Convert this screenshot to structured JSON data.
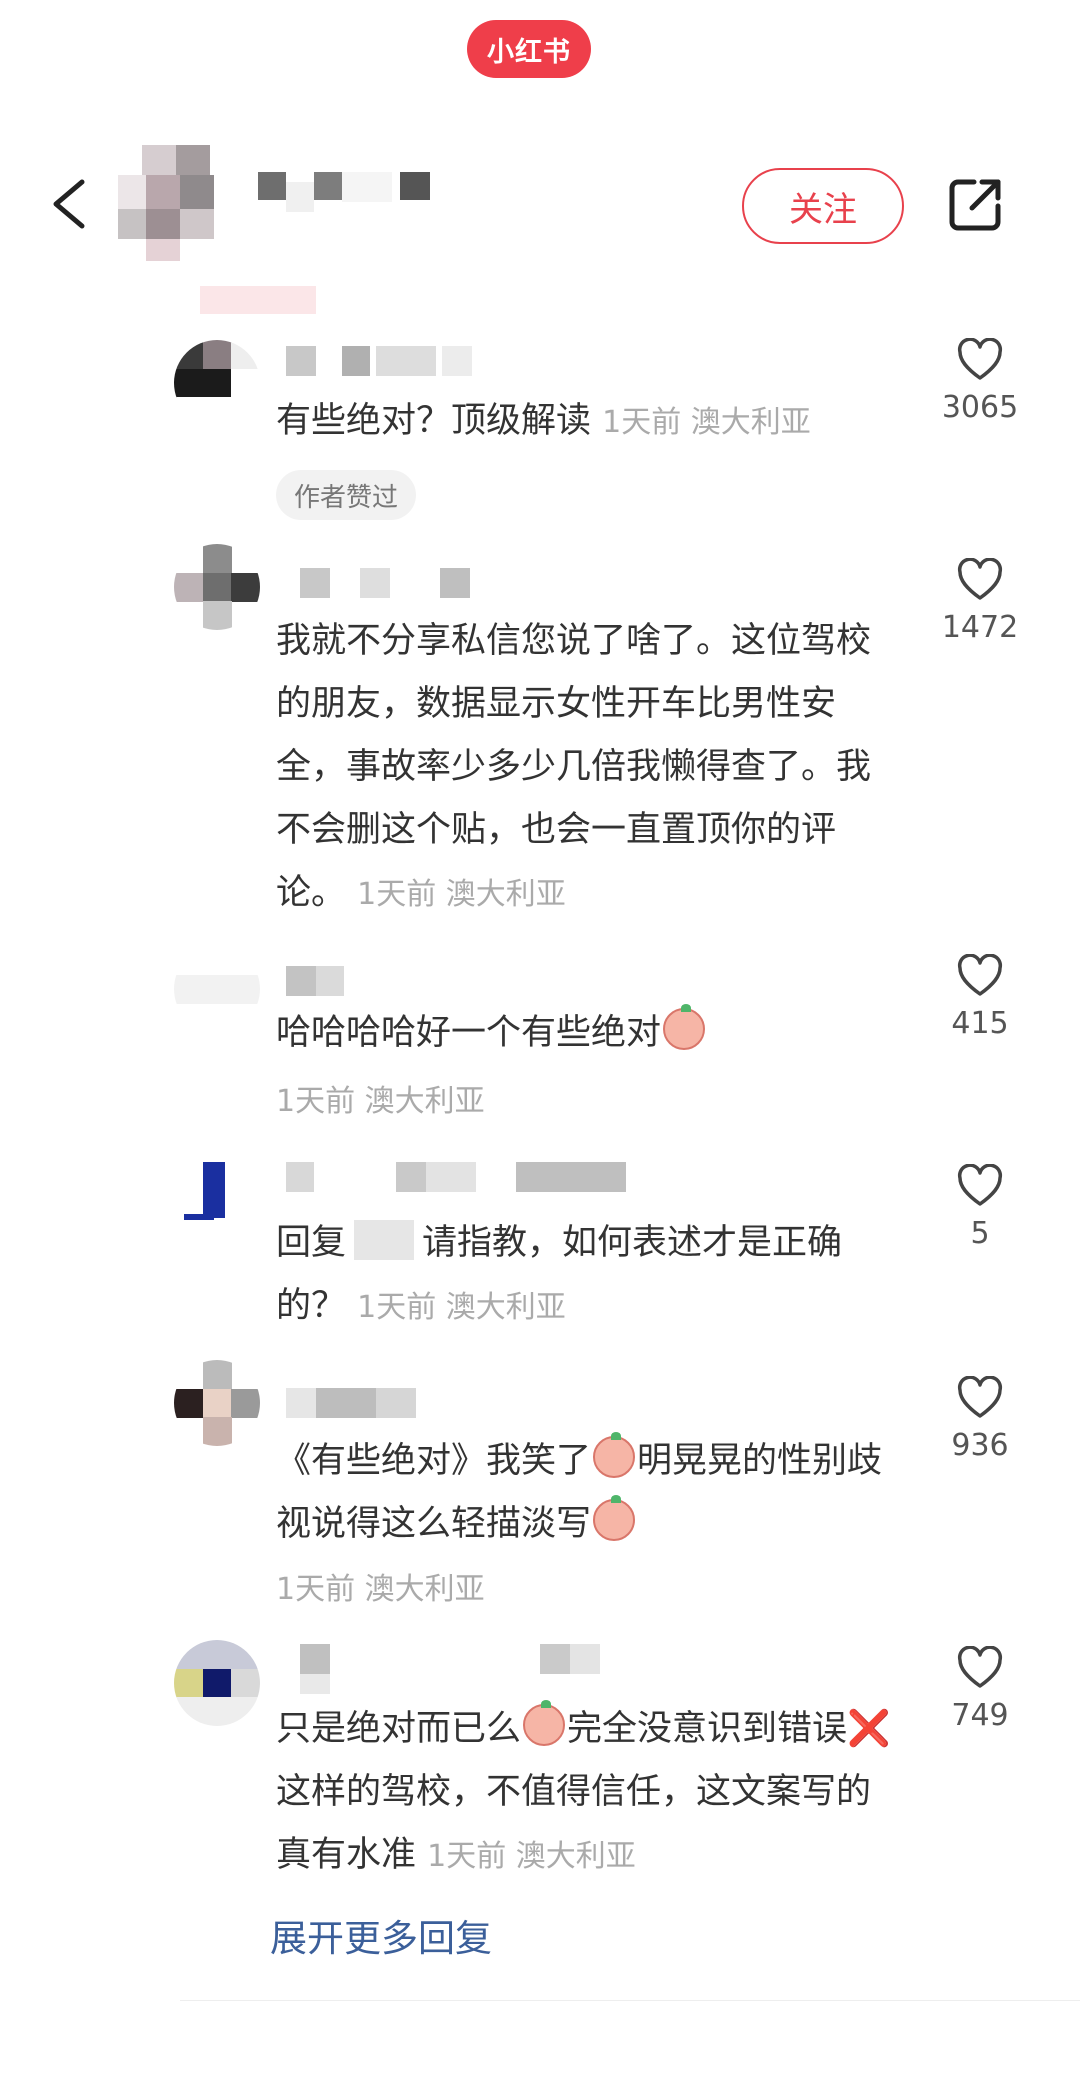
{
  "app": {
    "watermark": "小红书"
  },
  "header": {
    "follow_label": "关注"
  },
  "comments": [
    {
      "text": "有些绝对？顶级解读",
      "time": "1天前",
      "location": "澳大利亚",
      "likes": "3065",
      "badge": "作者赞过"
    },
    {
      "text": "我就不分享私信您说了啥了。这位驾校的朋友，数据显示女性开车比男性安全，事故率少多少几倍我懒得查了。我不会删这个贴，也会一直置顶你的评论。",
      "time": "1天前",
      "location": "澳大利亚",
      "likes": "1472"
    },
    {
      "text": "哈哈哈哈好一个有些绝对",
      "time": "1天前",
      "location": "澳大利亚",
      "likes": "415"
    },
    {
      "text_prefix": "回复",
      "text": "请指教，如何表述才是正确的？",
      "time": "1天前",
      "location": "澳大利亚",
      "likes": "5"
    },
    {
      "text_a": "《有些绝对》我笑了",
      "text_b": "明晃晃的性别歧视说得这么轻描淡写",
      "time": "1天前",
      "location": "澳大利亚",
      "likes": "936"
    },
    {
      "text_a": "只是绝对而已么",
      "text_b": "完全没意识到错误",
      "cross": "❌",
      "text_c": "这样的驾校，不值得信任，这文案写的真有水准",
      "time": "1天前",
      "location": "澳大利亚",
      "likes": "749"
    }
  ],
  "expand_label": "展开更多回复",
  "icons": {
    "back": "back-chevron-icon",
    "share": "share-icon",
    "like": "heart-icon",
    "emoji": "peach-emoji-icon"
  },
  "colors": {
    "brand": "#ef3e4a",
    "link": "#3b5f9a",
    "meta": "#aaaaaa"
  }
}
